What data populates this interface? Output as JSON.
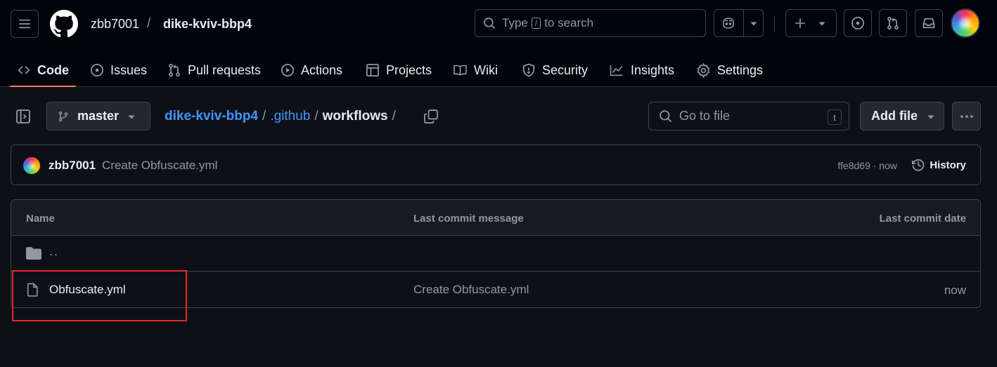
{
  "header": {
    "owner": "zbb7001",
    "separator": "/",
    "repo": "dike-kviv-bbp4",
    "search": {
      "prefix": "Type",
      "key": "/",
      "suffix": "to search"
    }
  },
  "nav": {
    "tabs": [
      {
        "label": "Code",
        "icon": "code-icon",
        "active": true
      },
      {
        "label": "Issues",
        "icon": "issue-opened-icon"
      },
      {
        "label": "Pull requests",
        "icon": "git-pull-request-icon"
      },
      {
        "label": "Actions",
        "icon": "play-icon"
      },
      {
        "label": "Projects",
        "icon": "table-icon"
      },
      {
        "label": "Wiki",
        "icon": "book-icon"
      },
      {
        "label": "Security",
        "icon": "shield-icon"
      },
      {
        "label": "Insights",
        "icon": "graph-icon"
      },
      {
        "label": "Settings",
        "icon": "gear-icon"
      }
    ]
  },
  "toolbar": {
    "branch": "master",
    "path": [
      {
        "label": "dike-kviv-bbp4"
      },
      {
        "label": ".github"
      },
      {
        "label": "workflows"
      }
    ],
    "path_sep": "/",
    "go_to_file": "Go to file",
    "go_to_file_key": "t",
    "add_file": "Add file"
  },
  "commit": {
    "author": "zbb7001",
    "message": "Create Obfuscate.yml",
    "meta": "ffe8d69 · now",
    "history": "History"
  },
  "files": {
    "columns": [
      "Name",
      "Last commit message",
      "Last commit date"
    ],
    "parent": "..",
    "rows": [
      {
        "name": "Obfuscate.yml",
        "message": "Create Obfuscate.yml",
        "date": "now"
      }
    ]
  },
  "colors": {
    "accent_tab": "#f78166",
    "link": "#4493f8",
    "highlight": "#e5252a"
  }
}
